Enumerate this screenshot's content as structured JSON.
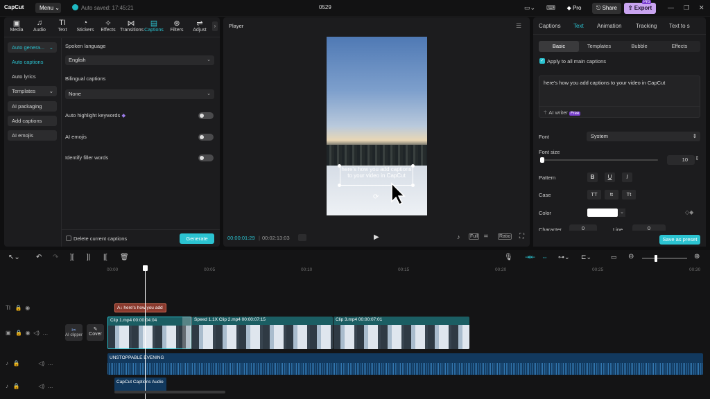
{
  "titlebar": {
    "logo": "CapCut",
    "menu_label": "Menu",
    "autosave": "Auto saved: 17:45:21",
    "project_title": "0529",
    "pro_label": "Pro",
    "share_label": "Share",
    "export_label": "Export",
    "export_tag": "Pro",
    "accent": "#2bc3d1"
  },
  "tools": [
    {
      "label": "Media",
      "icon": "media-icon",
      "glyph": "▣"
    },
    {
      "label": "Audio",
      "icon": "audio-icon",
      "glyph": "♫"
    },
    {
      "label": "Text",
      "icon": "text-icon",
      "glyph": "TI"
    },
    {
      "label": "Stickers",
      "icon": "stickers-icon",
      "glyph": "◔"
    },
    {
      "label": "Effects",
      "icon": "effects-icon",
      "glyph": "✧"
    },
    {
      "label": "Transitions",
      "icon": "transitions-icon",
      "glyph": "⋈"
    },
    {
      "label": "Captions",
      "icon": "captions-icon",
      "glyph": "▤"
    },
    {
      "label": "Filters",
      "icon": "filters-icon",
      "glyph": "⊛"
    },
    {
      "label": "Adjust",
      "icon": "adjust-icon",
      "glyph": "⇌"
    }
  ],
  "sidebar": {
    "items": [
      {
        "label": "Auto genera...",
        "style": "filled-active"
      },
      {
        "label": "Auto captions",
        "style": "active"
      },
      {
        "label": "Auto lyrics",
        "style": "plain"
      },
      {
        "label": "Templates",
        "style": "filled"
      },
      {
        "label": "AI packaging",
        "style": "filled"
      },
      {
        "label": "Add captions",
        "style": "filled"
      },
      {
        "label": "AI emojis",
        "style": "filled"
      }
    ]
  },
  "captions_panel": {
    "spoken_language_label": "Spoken language",
    "spoken_language_value": "English",
    "bilingual_label": "Bilingual captions",
    "bilingual_value": "None",
    "highlight_label": "Auto highlight keywords",
    "ai_emojis_label": "AI emojis",
    "filler_label": "Identify filler words",
    "delete_label": "Delete current captions",
    "generate_label": "Generate"
  },
  "player": {
    "title": "Player",
    "caption_text": "here's how you add captions to your video in CapCut",
    "current_time": "00:00:01:29",
    "total_time": "00:02:13:03",
    "full_label": "Full",
    "ratio_label": "Ratio"
  },
  "right_panel": {
    "tabs": [
      "Captions",
      "Text",
      "Animation",
      "Tracking",
      "Text to s"
    ],
    "active_tab": "Text",
    "subtabs": [
      "Basic",
      "Templates",
      "Bubble",
      "Effects"
    ],
    "apply_all_label": "Apply to all main captions",
    "text_value": "here's how you add captions to your video in CapCut",
    "ai_writer_label": "AI writer",
    "ai_writer_badge": "Free",
    "font_label": "Font",
    "font_value": "System",
    "font_size_label": "Font size",
    "font_size_value": "10",
    "font_size_level": 0.02,
    "pattern_label": "Pattern",
    "pattern_buttons": [
      "B",
      "U",
      "I"
    ],
    "case_label": "Case",
    "case_buttons": [
      "TT",
      "tt",
      "Tt"
    ],
    "color_label": "Color",
    "color_value": "#ffffff",
    "character_label": "Character",
    "character_value": "0",
    "line_label": "Line",
    "line_value": "0",
    "save_preset_label": "Save as preset"
  },
  "timeline": {
    "ruler": [
      "00:00",
      "00:05",
      "00:10",
      "00:15",
      "00:20",
      "00:25",
      "00:30"
    ],
    "caption_clip": "here's how you add",
    "clips": [
      {
        "label": "Clip 1.mp4   00:00:04:04"
      },
      {
        "label": "Speed 1.1X   Clip 2.mp4   00:00:07:15"
      },
      {
        "label": "Clip 3.mp4   00:00:07:01"
      }
    ],
    "ai_clipper_label": "AI clipper",
    "cover_label": "Cover",
    "audio_track": "UNSTOPPABLE EVENING",
    "caption_audio": "CapCut Captions Audio"
  }
}
